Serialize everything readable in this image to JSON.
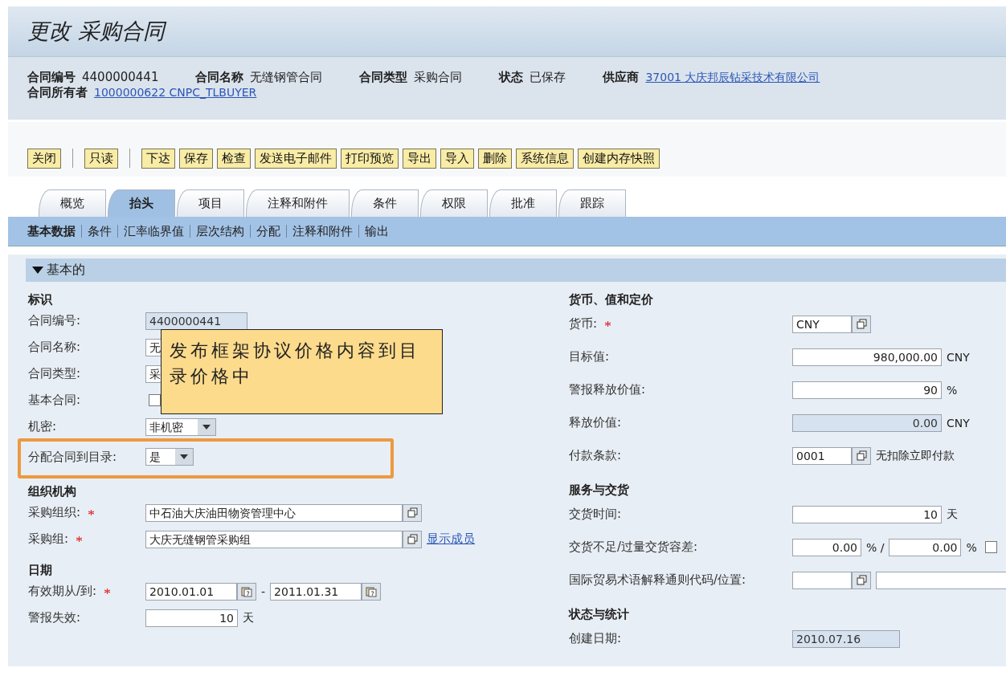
{
  "window": {
    "title": "更改 采购合同"
  },
  "header": {
    "fields": [
      {
        "label": "合同编号",
        "value": "4400000441",
        "kind": "text"
      },
      {
        "label": "合同名称",
        "value": "无缝钢管合同",
        "kind": "text"
      },
      {
        "label": "合同类型",
        "value": "采购合同",
        "kind": "text"
      },
      {
        "label": "状态",
        "value": "已保存",
        "kind": "text"
      },
      {
        "label": "供应商",
        "value": "37001 大庆邦辰钻采技术有限公司",
        "kind": "link"
      },
      {
        "label": "合同所有者",
        "value": "1000000622 CNPC_TLBUYER",
        "kind": "link"
      }
    ]
  },
  "toolbar": [
    [
      "关闭"
    ],
    [
      "只读"
    ],
    [
      "下达",
      "保存",
      "检查",
      "发送电子邮件",
      "打印预览",
      "导出",
      "导入",
      "删除",
      "系统信息",
      "创建内存快照"
    ]
  ],
  "tabs": [
    {
      "label": "概览",
      "selected": false
    },
    {
      "label": "抬头",
      "selected": true
    },
    {
      "label": "项目",
      "selected": false
    },
    {
      "label": "注释和附件",
      "selected": false
    },
    {
      "label": "条件",
      "selected": false
    },
    {
      "label": "权限",
      "selected": false
    },
    {
      "label": "批准",
      "selected": false
    },
    {
      "label": "跟踪",
      "selected": false
    }
  ],
  "subtabs": [
    {
      "label": "基本数据",
      "selected": true
    },
    {
      "label": "条件",
      "selected": false
    },
    {
      "label": "汇率临界值",
      "selected": false
    },
    {
      "label": "层次结构",
      "selected": false
    },
    {
      "label": "分配",
      "selected": false
    },
    {
      "label": "注释和附件",
      "selected": false
    },
    {
      "label": "输出",
      "selected": false
    }
  ],
  "section": {
    "title": "基本的",
    "expanded": true
  },
  "left": [
    {
      "heading": "标识",
      "rows": [
        {
          "label": "合同编号:",
          "required": false,
          "kind": "readonly",
          "value": "4400000441"
        },
        {
          "label": "合同名称:",
          "required": false,
          "kind": "input",
          "value": "无"
        },
        {
          "label": "合同类型:",
          "required": false,
          "kind": "input",
          "value": "采"
        },
        {
          "label": "基本合同:",
          "required": false,
          "kind": "checkbox",
          "checked": false
        },
        {
          "label": "机密:",
          "required": false,
          "kind": "dropdown",
          "value": "非机密"
        },
        {
          "label": "分配合同到目录:",
          "required": false,
          "kind": "dropdown",
          "value": "是",
          "highlighted": true
        }
      ]
    },
    {
      "heading": "组织机构",
      "rows": [
        {
          "label": "采购组织:",
          "required": true,
          "kind": "lookup",
          "value": "中石油大庆油田物资管理中心"
        },
        {
          "label": "采购组:",
          "required": true,
          "kind": "lookup",
          "value": "大庆无缝钢管采购组",
          "link": "显示成员"
        }
      ]
    },
    {
      "heading": "日期",
      "rows": [
        {
          "label": "有效期从/到:",
          "required": true,
          "kind": "date_range",
          "from": "2010.01.01",
          "separator": "-",
          "to": "2011.01.31"
        },
        {
          "label": "警报失效:",
          "required": false,
          "kind": "number",
          "value": "10",
          "unit": "天"
        }
      ]
    }
  ],
  "right": [
    {
      "heading": "货币、值和定价",
      "rows": [
        {
          "label": "货币:",
          "required": true,
          "kind": "lookup",
          "value": "CNY"
        },
        {
          "label": "目标值:",
          "required": false,
          "kind": "number",
          "value": "980,000.00",
          "unit": "CNY"
        },
        {
          "label": "警报释放价值:",
          "required": false,
          "kind": "number",
          "value": "90",
          "unit": "%"
        },
        {
          "label": "释放价值:",
          "required": false,
          "kind": "readonly_number",
          "value": "0.00",
          "unit": "CNY"
        },
        {
          "label": "付款条款:",
          "required": false,
          "kind": "lookup",
          "value": "0001",
          "description": "无扣除立即付款"
        }
      ]
    },
    {
      "heading": "服务与交货",
      "rows": [
        {
          "label": "交货时间:",
          "required": false,
          "kind": "number",
          "value": "10",
          "unit": "天"
        },
        {
          "label": "交货不足/过量交货容差:",
          "required": false,
          "kind": "tolerance",
          "under": "0.00",
          "under_unit": "% /",
          "over": "0.00",
          "over_unit": "%",
          "checked": false
        },
        {
          "label": "国际贸易术语解释通则代码/位置:",
          "required": false,
          "kind": "incoterms"
        }
      ]
    },
    {
      "heading": "状态与统计",
      "rows": [
        {
          "label": "创建日期:",
          "required": false,
          "kind": "readonly",
          "value": "2010.07.16"
        }
      ]
    }
  ],
  "callout": {
    "text": "发布框架协议价格内容到目录价格中"
  }
}
